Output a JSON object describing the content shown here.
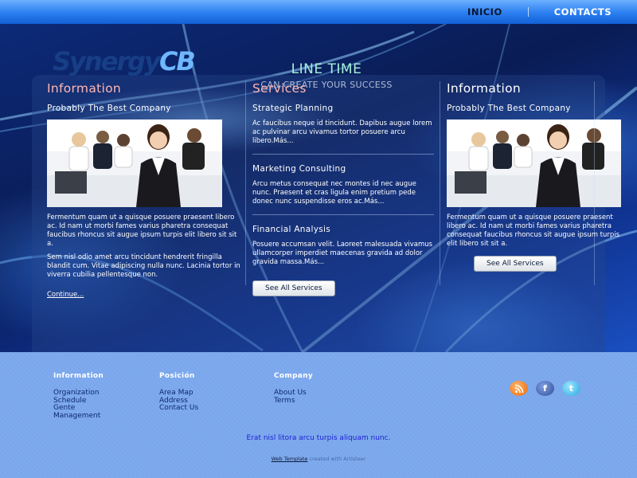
{
  "nav": {
    "items": [
      {
        "label": "INICIO"
      },
      {
        "label": "CONTACTS"
      }
    ]
  },
  "logo": {
    "part1": "Synergy",
    "part2": "CB"
  },
  "slogan": {
    "title": "LINE TIME",
    "subtitle": "CAN CREATE YOUR SUCCESS"
  },
  "columns": {
    "left": {
      "heading": "Information",
      "subheading": "Probably The Best Company",
      "para1": "Fermentum quam ut a quisque posuere praesent libero ac. Id nam ut morbi fames varius pharetra consequat faucibus rhoncus sit augue ipsum turpis elit libero sit sit a.",
      "para2": "Sem nisl odio amet arcu tincidunt hendrerit fringilla blandit cum. Vitae adipiscing nulla nunc. Lacinia tortor in viverra cubilia pellentesque non.",
      "more": "Continue..."
    },
    "middle": {
      "heading": "Services",
      "items": [
        {
          "title": "Strategic Planning",
          "text": "Ac faucibus neque id tincidunt. Dapibus augue lorem ac pulvinar arcu vivamus tortor posuere arcu libero.Más..."
        },
        {
          "title": "Marketing Consulting",
          "text": "Arcu metus consequat nec montes id nec augue nunc. Praesent et cras ligula enim pretium pede donec nunc suspendisse eros ac.Más..."
        },
        {
          "title": "Financial Analysis",
          "text": "Posuere accumsan velit. Laoreet malesuada vivamus ullamcorper imperdiet maecenas gravida ad dolor gravida massa.Más..."
        }
      ],
      "button": "See All Services"
    },
    "right": {
      "heading": "Information",
      "subheading": "Probably The Best Company",
      "para1": "Fermentum quam ut a quisque posuere praesent libero ac. Id nam ut morbi fames varius pharetra consequat faucibus rhoncus sit augue ipsum turpis elit libero sit sit a.",
      "button": "See All Services"
    }
  },
  "footer": {
    "col1": {
      "heading": "Information",
      "links": [
        "Organization",
        "Schedule",
        "Gente",
        "Management"
      ]
    },
    "col2": {
      "heading": "Posición",
      "links": [
        "Area Map",
        "Address",
        "Contact Us"
      ]
    },
    "col3": {
      "heading": "Company",
      "links": [
        "About Us",
        "Terms"
      ]
    },
    "social": {
      "rss": "rss-icon",
      "facebook": "facebook-icon",
      "twitter": "twitter-icon"
    },
    "tagline": "Erat nisl litora arcu turpis aliquam nunc.",
    "credit_link": "Web Template",
    "credit_text": "created with Artisteer"
  },
  "colors": {
    "accent_pink": "#ffb6b2",
    "nav_blue": "#2a7ef0",
    "footer_blue": "#7aa7ec"
  }
}
